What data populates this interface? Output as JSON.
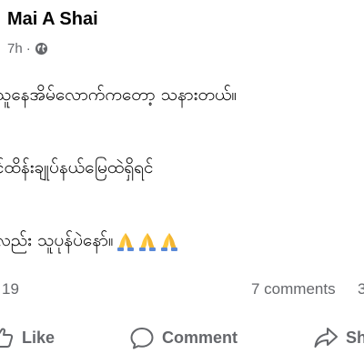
{
  "post": {
    "author": "Mai A Shai",
    "time": "7h",
    "separator": "·",
    "privacy_icon": "globe-icon",
    "lines": [
      "သူနေအိမ်လောက်ကတော့ သနားတယ်။",
      "င်ထိန်းချုပ်နယ်မြေထဲရှိရင်",
      "လည်း သူပုန်ပဲနော်။"
    ],
    "emojis": [
      "folded-hands-icon",
      "folded-hands-icon",
      "folded-hands-icon"
    ]
  },
  "stats": {
    "reactions": "19",
    "comments": "7 comments",
    "shares": "3"
  },
  "actions": {
    "like": "Like",
    "comment": "Comment",
    "share": "Sh"
  },
  "colors": {
    "text": "#050505",
    "secondary": "#65676b",
    "emoji_yellow": "#ffc83d",
    "emoji_blue": "#5b8ad8"
  }
}
